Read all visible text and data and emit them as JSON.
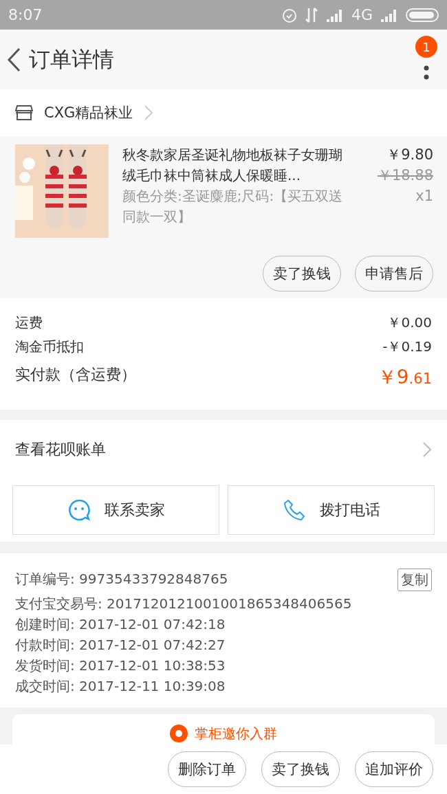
{
  "status_bar": {
    "time": "8:07",
    "network": "4G"
  },
  "header": {
    "title": "订单详情",
    "badge": "1"
  },
  "shop": {
    "name": "CXG精品袜业"
  },
  "product": {
    "image": {
      "kind": "picture"
    },
    "title": "秋冬款家居圣诞礼物地板袜子女珊瑚绒毛巾袜中筒袜成人保暖睡...",
    "sku": "颜色分类:圣诞麋鹿;尺码:【买五双送同款一双】",
    "price": "￥9.80",
    "original_price": "￥18.88",
    "quantity": "x1",
    "actions": [
      "卖了换钱",
      "申请售后"
    ]
  },
  "fees": [
    {
      "label": "运费",
      "value": "￥0.00",
      "kind": "plain"
    },
    {
      "label": "淘金币抵扣",
      "value": "-￥0.19",
      "kind": "plain"
    },
    {
      "label": "实付款（含运费）",
      "value": "￥9",
      "value_small": ".61",
      "kind": "total"
    }
  ],
  "huabei": {
    "label": "查看花呗账单"
  },
  "contact_buttons": [
    {
      "label": "联系卖家",
      "kind": "chat"
    },
    {
      "label": "拨打电话",
      "kind": "phone"
    }
  ],
  "order_info": {
    "copy_button": "复制",
    "lines": [
      {
        "label": "订单编号:",
        "value": "99735433792848765"
      },
      {
        "label": "支付宝交易号:",
        "value": "2017120121001001865348406565"
      },
      {
        "label": "创建时间:",
        "value": "2017-12-01 07:42:18"
      },
      {
        "label": "付款时间:",
        "value": "2017-12-01 07:42:27"
      },
      {
        "label": "发货时间:",
        "value": "2017-12-01 10:38:53"
      },
      {
        "label": "成交时间:",
        "value": "2017-12-11 10:39:08"
      }
    ]
  },
  "group_banner": {
    "text": "掌柜邀你入群"
  },
  "bottom_actions": [
    "删除订单",
    "卖了换钱",
    "追加评价"
  ]
}
